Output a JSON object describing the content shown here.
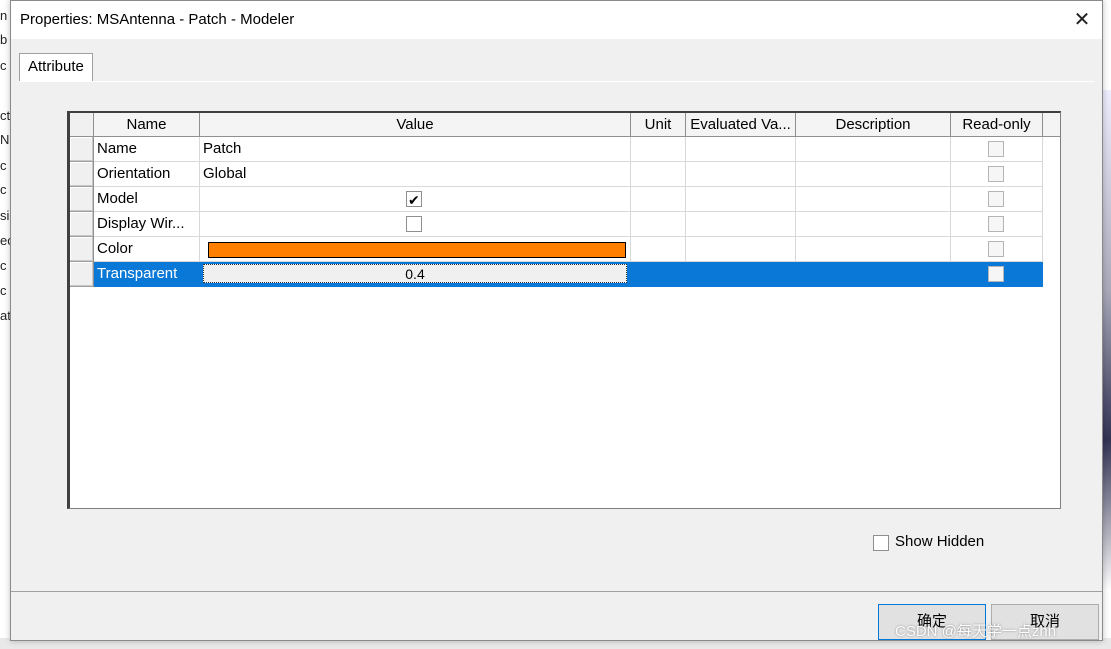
{
  "dialog": {
    "title": "Properties: MSAntenna - Patch - Modeler",
    "close_glyph": "✕"
  },
  "tabs": [
    {
      "label": "Attribute"
    }
  ],
  "grid": {
    "columns": [
      "Name",
      "Value",
      "Unit",
      "Evaluated Va...",
      "Description",
      "Read-only"
    ],
    "rows": [
      {
        "name": "Name",
        "value": "Patch",
        "value_type": "text",
        "read_only": false
      },
      {
        "name": "Orientation",
        "value": "Global",
        "value_type": "text",
        "read_only": false
      },
      {
        "name": "Model",
        "value": true,
        "value_type": "checkbox",
        "read_only": false
      },
      {
        "name": "Display Wir...",
        "value": false,
        "value_type": "checkbox",
        "read_only": false
      },
      {
        "name": "Color",
        "value": "#ff8000",
        "value_type": "color",
        "read_only": false
      },
      {
        "name": "Transparent",
        "value": "0.4",
        "value_type": "edit",
        "read_only": false,
        "selected": true
      }
    ]
  },
  "show_hidden": {
    "label": "Show Hidden",
    "checked": false
  },
  "buttons": {
    "ok": "确定",
    "cancel": "取消"
  },
  "watermark": "CSDN @每天学一点zhn",
  "colors": {
    "selection": "#0a78d7",
    "accent": "#0078d7",
    "color_swatch": "#ff8000"
  }
}
